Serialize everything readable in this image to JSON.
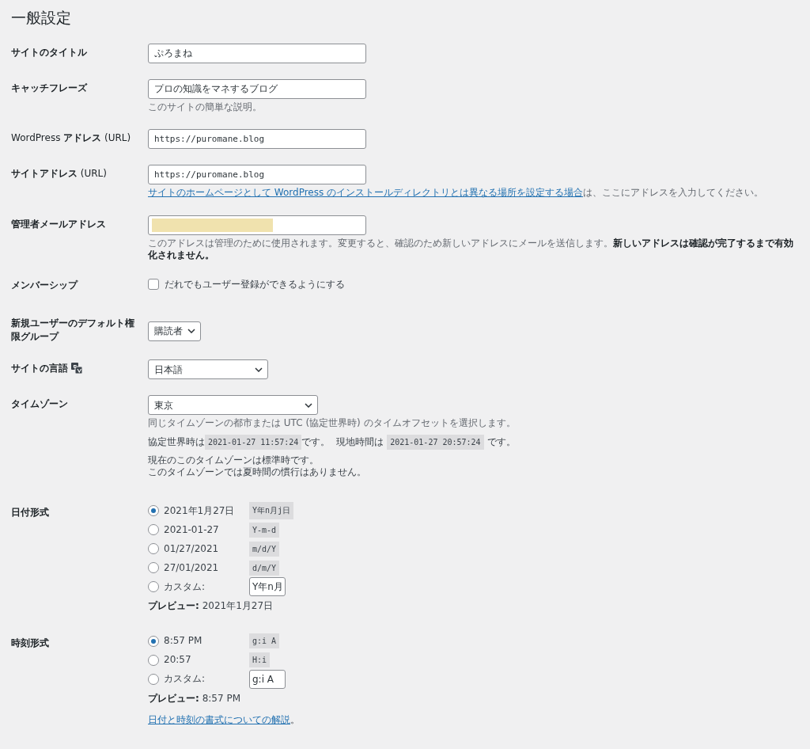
{
  "page_title": "一般設定",
  "settings": [
    {
      "kind": "text",
      "label": "サイトのタイトル",
      "value": "ぷろまね"
    },
    {
      "kind": "text",
      "label": "キャッチフレーズ",
      "value": "プロの知識をマネするブログ",
      "description": "このサイトの簡単な説明。"
    },
    {
      "kind": "url",
      "label": "WordPress **アドレス** (URL)",
      "value": "https://puromane.blog"
    },
    {
      "kind": "url",
      "label": "**サイトアドレス** (URL)",
      "value": "https://puromane.blog",
      "description_link": "サイトのホームページとして WordPress のインストールディレクトリとは異なる場所を設定する場合",
      "description": "は、ここにアドレスを入力してください。"
    },
    {
      "kind": "email",
      "label": "管理者メールアドレス",
      "redacted": true,
      "description": "このアドレスは管理のために使用されます。変更すると、確認のため新しいアドレスにメールを送信します。**新しいアドレスは確認が完了するまで有効化されません。**"
    },
    {
      "kind": "checkbox",
      "label": "メンバーシップ",
      "option": "だれでもユーザー登録ができるようにする",
      "checked": false
    },
    {
      "kind": "select",
      "label": "新規ユーザーのデフォルト権限グループ",
      "value": "購読者"
    },
    {
      "kind": "language",
      "label": "サイトの言語",
      "value": "日本語"
    },
    {
      "kind": "timezone",
      "label": "タイムゾーン",
      "value": "東京",
      "description": "同じタイムゾーンの都市または UTC (協定世界時) のタイムオフセットを選択します。",
      "utc_label": "協定世界時は",
      "utc_time": "2021-01-27 11:57:24",
      "utc_suffix": "です。",
      "local_label": "現地時間は",
      "local_time": "2021-01-27 20:57:24",
      "local_suffix": "です。",
      "notes": [
        "現在のこのタイムゾーンは標準時です。",
        "このタイムゾーンでは夏時間の慣行はありません。"
      ]
    },
    {
      "kind": "radios",
      "label": "日付形式",
      "options": [
        {
          "label": "2021年1月27日",
          "format": "Y年n月j日",
          "selected": true
        },
        {
          "label": "2021-01-27",
          "format": "Y-m-d",
          "selected": false
        },
        {
          "label": "01/27/2021",
          "format": "m/d/Y",
          "selected": false
        },
        {
          "label": "27/01/2021",
          "format": "d/m/Y",
          "selected": false
        },
        {
          "label": "カスタム:",
          "custom_value": "Y年n月",
          "selected": false
        }
      ],
      "preview_label": "プレビュー:",
      "preview": "2021年1月27日"
    },
    {
      "kind": "radios",
      "label": "時刻形式",
      "options": [
        {
          "label": "8:57 PM",
          "format": "g:i A",
          "selected": true
        },
        {
          "label": "20:57",
          "format": "H:i",
          "selected": false
        },
        {
          "label": "カスタム:",
          "custom_value": "g:i A",
          "selected": false
        }
      ],
      "preview_label": "プレビュー:",
      "preview": "8:57 PM",
      "help_link": "日付と時刻の書式についての解説",
      "help_suffix": "。"
    }
  ]
}
